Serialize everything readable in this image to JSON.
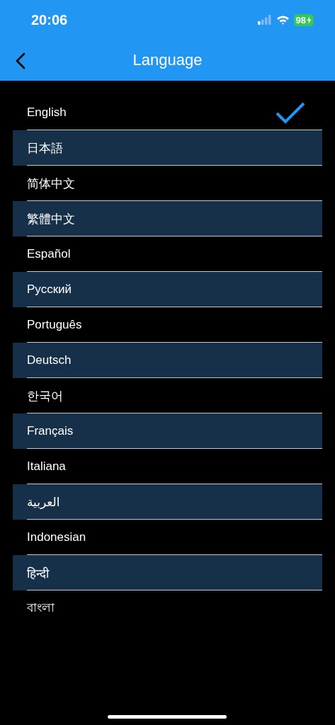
{
  "status_bar": {
    "time": "20:06",
    "battery": "98"
  },
  "nav": {
    "title": "Language"
  },
  "languages": [
    {
      "label": "English",
      "selected": true
    },
    {
      "label": "日本語",
      "selected": false
    },
    {
      "label": "简体中文",
      "selected": false
    },
    {
      "label": "繁體中文",
      "selected": false
    },
    {
      "label": "Español",
      "selected": false
    },
    {
      "label": "Русский",
      "selected": false
    },
    {
      "label": "Português",
      "selected": false
    },
    {
      "label": "Deutsch",
      "selected": false
    },
    {
      "label": "한국어",
      "selected": false
    },
    {
      "label": "Français",
      "selected": false
    },
    {
      "label": "Italiana",
      "selected": false
    },
    {
      "label": "العربية",
      "selected": false
    },
    {
      "label": "Indonesian",
      "selected": false
    },
    {
      "label": "हिन्दी",
      "selected": false
    },
    {
      "label": "বাংলা",
      "selected": false
    }
  ]
}
